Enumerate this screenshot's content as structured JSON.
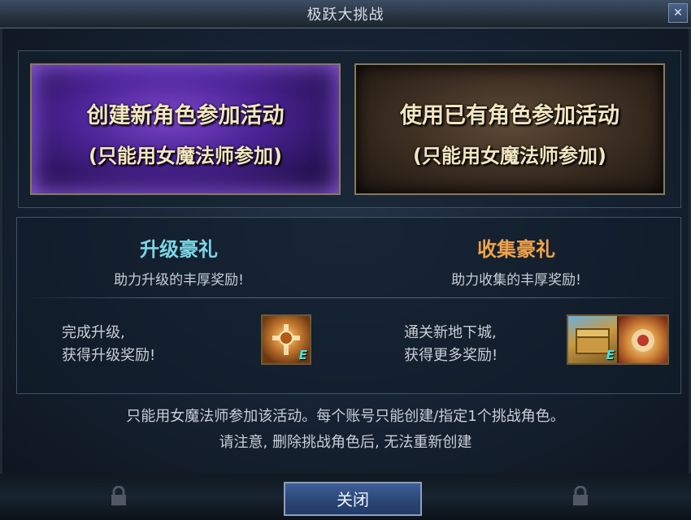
{
  "window": {
    "title": "极跃大挑战",
    "close_icon": "close-icon"
  },
  "cards": [
    {
      "title": "创建新角色参加活动",
      "subtitle": "(只能用女魔法师参加)",
      "accent": "#6a35c0"
    },
    {
      "title": "使用已有角色参加活动",
      "subtitle": "(只能用女魔法师参加)",
      "accent": "#4a3826"
    }
  ],
  "rewards": {
    "level": {
      "title": "升级豪礼",
      "desc": "助力升级的丰厚奖励!",
      "cond_line1": "完成升级,",
      "cond_line2": "获得升级奖励!",
      "icon": "gear-icon",
      "badge": "E",
      "color": "#7ad7e6"
    },
    "collect": {
      "title": "收集豪礼",
      "desc": "助力收集的丰厚奖励!",
      "cond_line1": "通关新地下城,",
      "cond_line2": "获得更多奖励!",
      "icons": [
        "chest-icon",
        "treasure-icon"
      ],
      "badge": "E",
      "color": "#f2a24a"
    }
  },
  "notes": {
    "line1": "只能用女魔法师参加该活动。每个账号只能创建/指定1个挑战角色。",
    "line2": "请注意, 删除挑战角色后, 无法重新创建"
  },
  "footer": {
    "close_label": "关闭",
    "lock_icon": "lock-icon"
  }
}
